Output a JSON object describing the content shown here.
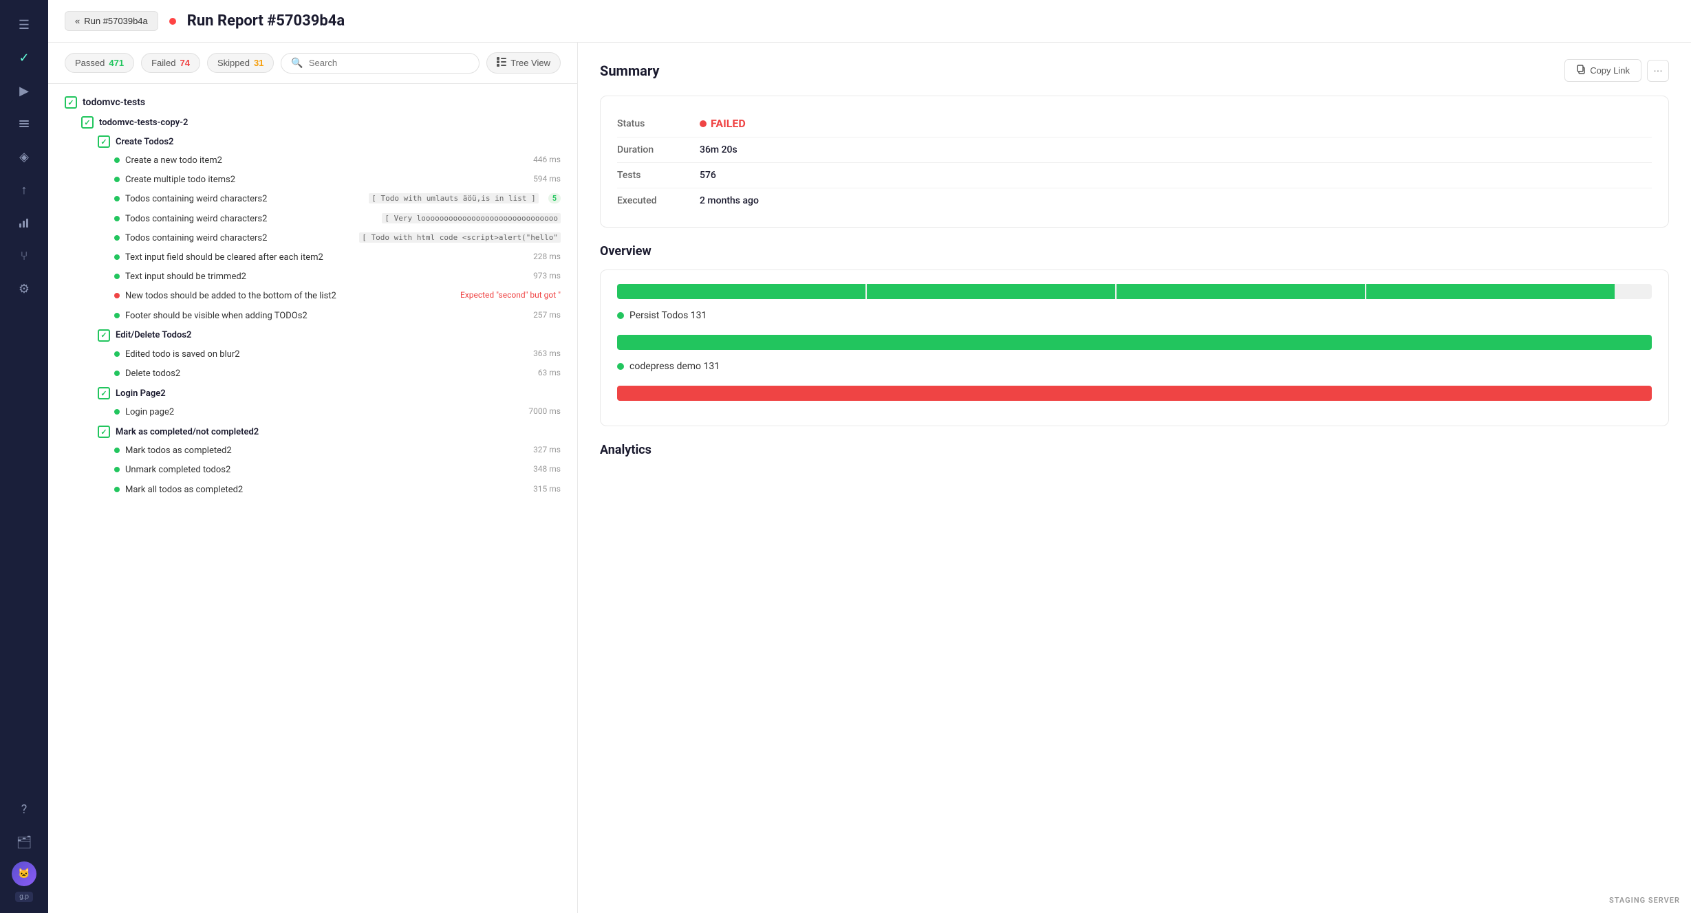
{
  "sidebar": {
    "icons": [
      {
        "name": "menu-icon",
        "symbol": "☰",
        "active": false
      },
      {
        "name": "check-icon",
        "symbol": "✓",
        "active": false
      },
      {
        "name": "play-icon",
        "symbol": "▶",
        "active": true
      },
      {
        "name": "list-icon",
        "symbol": "≡",
        "active": false
      },
      {
        "name": "layers-icon",
        "symbol": "◈",
        "active": false
      },
      {
        "name": "upload-icon",
        "symbol": "↑",
        "active": false
      },
      {
        "name": "chart-icon",
        "symbol": "📊",
        "active": false
      },
      {
        "name": "branch-icon",
        "symbol": "⑂",
        "active": false
      },
      {
        "name": "settings-icon",
        "symbol": "⚙",
        "active": false
      }
    ],
    "bottom_icons": [
      {
        "name": "help-icon",
        "symbol": "?"
      },
      {
        "name": "folder-icon",
        "symbol": "🗂"
      }
    ],
    "version": "g.p"
  },
  "header": {
    "back_label": "Run #57039b4a",
    "title": "Run Report #57039b4a",
    "status_dot_color": "#ff4444"
  },
  "filters": {
    "passed_label": "Passed",
    "passed_count": "471",
    "failed_label": "Failed",
    "failed_count": "74",
    "skipped_label": "Skipped",
    "skipped_count": "31",
    "search_placeholder": "Search",
    "tree_view_label": "Tree View"
  },
  "test_tree": {
    "root": "todomvc-tests",
    "suites": [
      {
        "name": "todomvc-tests-copy-2",
        "status": "mixed",
        "children": [
          {
            "name": "Create Todos2",
            "status": "pass",
            "tests": [
              {
                "name": "Create a new todo item2",
                "status": "pass",
                "duration": "446 ms",
                "tag": null,
                "error": null
              },
              {
                "name": "Create multiple todo items2",
                "status": "pass",
                "duration": "594 ms",
                "tag": null,
                "error": null
              },
              {
                "name": "Todos containing weird characters2",
                "status": "pass",
                "duration": null,
                "tag": "[ Todo with umlauts äöü,is in list ]",
                "count": "5",
                "error": null
              },
              {
                "name": "Todos containing weird characters2",
                "status": "pass",
                "duration": null,
                "tag": "[ Very loooooooooooooooooooooooooooooo",
                "error": null
              },
              {
                "name": "Todos containing weird characters2",
                "status": "pass",
                "duration": null,
                "tag": "[ Todo with html code <script>alert(\"hello\"",
                "error": null
              },
              {
                "name": "Text input field should be cleared after each item2",
                "status": "pass",
                "duration": "228 ms",
                "tag": null,
                "error": null
              },
              {
                "name": "Text input should be trimmed2",
                "status": "pass",
                "duration": "973 ms",
                "tag": null,
                "error": null
              },
              {
                "name": "New todos should be added to the bottom of the list2",
                "status": "fail",
                "duration": null,
                "tag": null,
                "error": "Expected \"second\" but got \""
              },
              {
                "name": "Footer should be visible when adding TODOs2",
                "status": "pass",
                "duration": "257 ms",
                "tag": null,
                "error": null
              }
            ]
          },
          {
            "name": "Edit/Delete Todos2",
            "status": "pass",
            "tests": [
              {
                "name": "Edited todo is saved on blur2",
                "status": "pass",
                "duration": "363 ms",
                "tag": null,
                "error": null
              },
              {
                "name": "Delete todos2",
                "status": "pass",
                "duration": "63 ms",
                "tag": null,
                "error": null
              }
            ]
          },
          {
            "name": "Login Page2",
            "status": "pass",
            "tests": [
              {
                "name": "Login page2",
                "status": "pass",
                "duration": "7000 ms",
                "tag": null,
                "error": null
              }
            ]
          },
          {
            "name": "Mark as completed/not completed2",
            "status": "pass",
            "tests": [
              {
                "name": "Mark todos as completed2",
                "status": "pass",
                "duration": "327 ms",
                "tag": null,
                "error": null
              },
              {
                "name": "Unmark completed todos2",
                "status": "pass",
                "duration": "348 ms",
                "tag": null,
                "error": null
              },
              {
                "name": "Mark all todos as completed2",
                "status": "pass",
                "duration": "315 ms",
                "tag": null,
                "error": null
              }
            ]
          }
        ]
      }
    ]
  },
  "summary": {
    "title": "Summary",
    "copy_link_label": "Copy Link",
    "more_label": "···",
    "status_label": "Status",
    "status_value": "FAILED",
    "duration_label": "Duration",
    "duration_value": "36m 20s",
    "tests_label": "Tests",
    "tests_value": "576",
    "executed_label": "Executed",
    "executed_value": "2 months ago"
  },
  "overview": {
    "title": "Overview",
    "bars": [
      {
        "label": "Persist Todos 131",
        "dot_color": "green",
        "segments": [
          {
            "color": "green",
            "pct": 100
          }
        ]
      },
      {
        "label": "codepress demo 131",
        "dot_color": "green",
        "segments": [
          {
            "color": "green",
            "pct": 100
          }
        ]
      },
      {
        "label": "",
        "dot_color": "red",
        "segments": [
          {
            "color": "red",
            "pct": 100
          }
        ]
      }
    ]
  },
  "analytics": {
    "title": "Analytics"
  },
  "staging": {
    "label": "STAGING SERVER"
  }
}
